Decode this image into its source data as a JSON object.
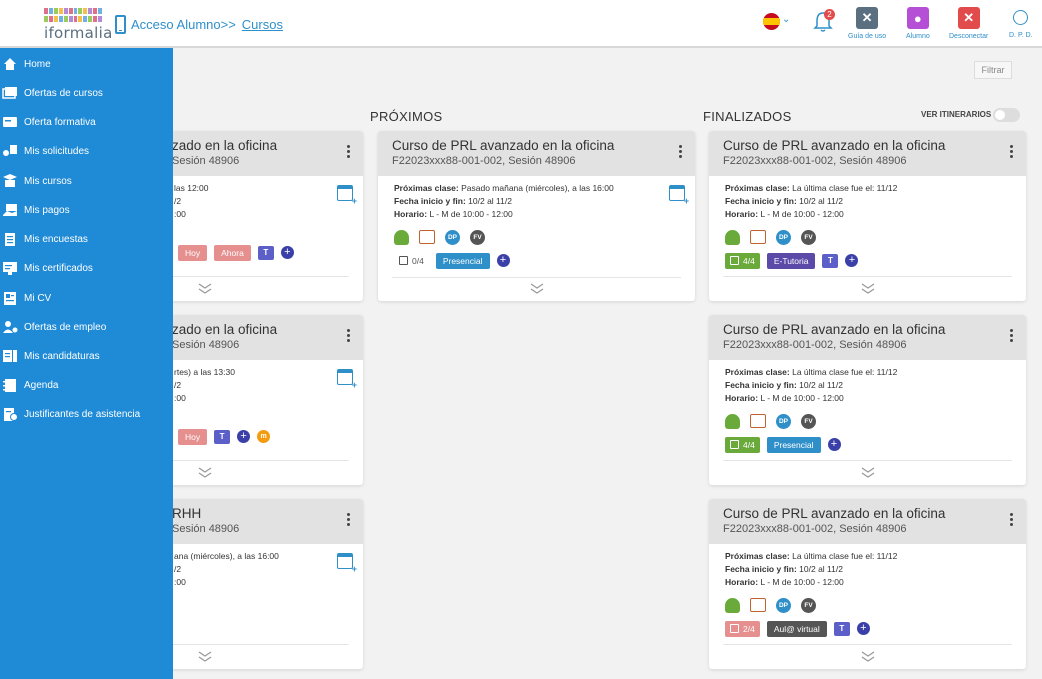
{
  "header": {
    "logo_text": "iformalia",
    "breadcrumb_parent": "Acceso Alumno>>",
    "breadcrumb_current": "Cursos",
    "notifications_count": "2",
    "buttons": [
      {
        "label": "Guía de uso",
        "color": "#5a6f80",
        "glyph": "✕"
      },
      {
        "label": "Alumno",
        "color": "#b44fd6",
        "glyph": "●"
      },
      {
        "label": "Desconectar",
        "color": "#e24b4b",
        "glyph": "✕"
      }
    ],
    "user_label": "D. P. D."
  },
  "toolbar": {
    "filter_label": "Filtrar",
    "itinerarios_label": "VER ITINERARIOS"
  },
  "columns": {
    "proximos": "PRÓXIMOS",
    "finalizados": "FINALIZADOS"
  },
  "sidebar": {
    "items": [
      {
        "label": "Home"
      },
      {
        "label": "Ofertas de cursos"
      },
      {
        "label": "Oferta formativa"
      },
      {
        "label": "Mis solicitudes"
      },
      {
        "label": "Mis cursos"
      },
      {
        "label": "Mis pagos"
      },
      {
        "label": "Mis  encuestas"
      },
      {
        "label": "Mis certificados"
      },
      {
        "label": "Mi CV"
      },
      {
        "label": "Ofertas de empleo"
      },
      {
        "label": "Mis candidaturas"
      },
      {
        "label": "Agenda"
      },
      {
        "label": "Justificantes de asistencia"
      }
    ]
  },
  "cards": {
    "c1": {
      "title": "zado en la oficina",
      "sub": "Sesión 48906",
      "l1": "las 12:00",
      "l2": "/2",
      "l3": ":00",
      "tag1": "Hoy",
      "tag2": "Ahora"
    },
    "c2": {
      "title": "zado en la oficina",
      "sub": "Sesión 48906",
      "l1": "rtes) a las 13:30",
      "l2": "/2",
      "l3": ":00",
      "tag1": "Hoy"
    },
    "c3": {
      "title": "RHH",
      "sub": "Sesión 48906",
      "l1": "ana (miércoles), a las 16:00",
      "l2": "/2",
      "l3": ":00"
    },
    "p1": {
      "title": "Curso de PRL avanzado en la oficina",
      "sub": "F22023xxx88-001-002, Sesión 48906",
      "k1": "Próximas clase:",
      "v1": "Pasado mañana (miércoles), a las 16:00",
      "k2": "Fecha inicio y fin:",
      "v2": "10/2 al 11/2",
      "k3": "Horario:",
      "v3": "L - M de 10:00 - 12:00",
      "progress": "0/4",
      "tag": "Presencial",
      "dp": "DP",
      "fv": "FV"
    },
    "f1": {
      "title": "Curso de PRL avanzado en la oficina",
      "sub": "F22023xxx88-001-002, Sesión 48906",
      "k1": "Próximas clase:",
      "v1": "La última clase fue el: 11/12",
      "k2": "Fecha inicio y fin:",
      "v2": "10/2 al 11/2",
      "k3": "Horario:",
      "v3": "L - M de 10:00 - 12:00",
      "progress": "4/4",
      "tag": "E-Tutoria",
      "dp": "DP",
      "fv": "FV"
    },
    "f2": {
      "title": "Curso de PRL avanzado en la oficina",
      "sub": "F22023xxx88-001-002, Sesión 48906",
      "k1": "Próximas clase:",
      "v1": "La última clase fue el: 11/12",
      "k2": "Fecha inicio y fin:",
      "v2": "10/2 al 11/2",
      "k3": "Horario:",
      "v3": "L - M de 10:00 - 12:00",
      "progress": "4/4",
      "tag": "Presencial",
      "dp": "DP",
      "fv": "FV"
    },
    "f3": {
      "title": "Curso de PRL avanzado en la oficina",
      "sub": "F22023xxx88-001-002, Sesión 48906",
      "k1": "Próximas clase:",
      "v1": "La última clase fue el: 11/12",
      "k2": "Fecha inicio y fin:",
      "v2": "10/2 al 11/2",
      "k3": "Horario:",
      "v3": "L - M de 10:00 - 12:00",
      "progress": "2/4",
      "tag": "Aul@ virtual",
      "dp": "DP",
      "fv": "FV"
    }
  },
  "colors": {
    "sidebar": "#1f8ad6",
    "accent": "#2f8fc9"
  }
}
